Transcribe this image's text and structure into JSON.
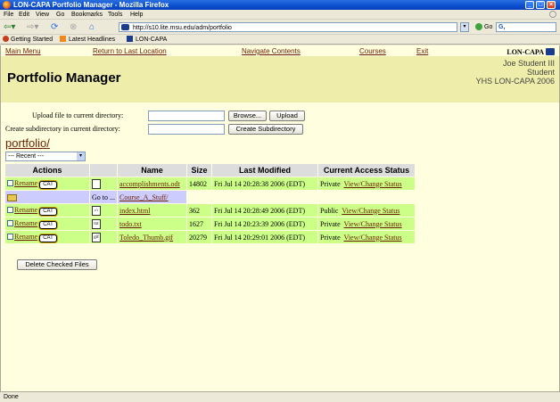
{
  "window": {
    "title": "LON-CAPA Portfolio Manager - Mozilla Firefox"
  },
  "menu": [
    "File",
    "Edit",
    "View",
    "Go",
    "Bookmarks",
    "Tools",
    "Help"
  ],
  "browser": {
    "url": "http://s10.lite.msu.edu/adm/portfolio",
    "go_label": "Go",
    "search_glyph": "G,"
  },
  "bookmarks": [
    "Getting Started",
    "Latest Headlines",
    "LON-CAPA"
  ],
  "toplinks": [
    "Main Menu",
    "Return to Last Location",
    "Navigate Contents",
    "Courses",
    "Exit"
  ],
  "logo_text": "LON-CAPA",
  "page_title": "Portfolio Manager",
  "user": {
    "name": "Joe Student III",
    "role": "Student",
    "course": "YHS LON-CAPA 2006"
  },
  "upload": {
    "label": "Upload file to current directory:",
    "browse": "Browse...",
    "submit": "Upload"
  },
  "subdir": {
    "label": "Create subdirectory in current directory:",
    "submit": "Create Subdirectory"
  },
  "path": {
    "dir": "portfolio",
    "slash": "/"
  },
  "recent": "--- Recent ---",
  "table": {
    "headers": [
      "Actions",
      "",
      "Name",
      "Size",
      "Last Modified",
      "Current Access Status"
    ],
    "rename": "Rename",
    "cat": "CAT",
    "goto": "Go to ...",
    "rows": [
      {
        "kind": "file",
        "icon": "",
        "name": "accomplishments.odt",
        "size": "14802",
        "modified": "Fri Jul 14 20:28:38 2006 (EDT)",
        "access": "Private",
        "action": "View/Change Status"
      },
      {
        "kind": "folder",
        "name": "Course_A_Stuff/"
      },
      {
        "kind": "file",
        "icon": "‹/›",
        "name": "index.html",
        "size": "362",
        "modified": "Fri Jul 14 20:28:49 2006 (EDT)",
        "access": "Public",
        "action": "View/Change Status"
      },
      {
        "kind": "file",
        "icon": "txt",
        "name": "todo.txt",
        "size": "1627",
        "modified": "Fri Jul 14 20:23:39 2006 (EDT)",
        "access": "Private",
        "action": "View/Change Status"
      },
      {
        "kind": "file",
        "icon": "gif",
        "name": "Toledo_Thumb.gif",
        "size": "20279",
        "modified": "Fri Jul 14 20:29:01 2006 (EDT)",
        "access": "Private",
        "action": "View/Change Status"
      }
    ]
  },
  "delete_label": "Delete Checked Files",
  "status": "Done"
}
